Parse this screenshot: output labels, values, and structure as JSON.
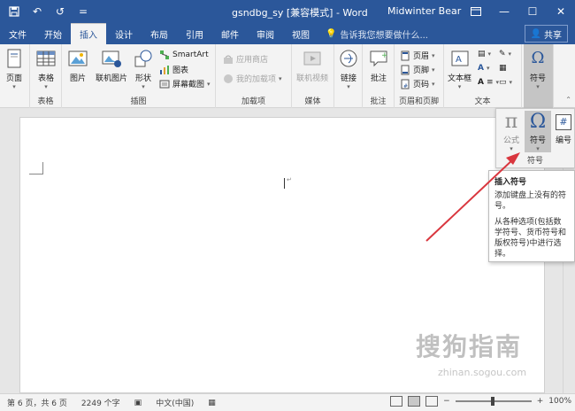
{
  "titlebar": {
    "doc_title": "gsndbg_sy [兼容模式] - Word",
    "user": "Midwinter Bear",
    "qat": [
      "save-icon",
      "undo-icon",
      "redo-icon",
      "customize-icon"
    ],
    "controls": [
      "minimize",
      "restore",
      "close"
    ]
  },
  "tabs": [
    "文件",
    "开始",
    "插入",
    "设计",
    "布局",
    "引用",
    "邮件",
    "审阅",
    "视图"
  ],
  "active_tab": "插入",
  "tell_me": "告诉我您想要做什么...",
  "share": "共享",
  "ribbon": {
    "pages": {
      "label": "页面",
      "group": "页面"
    },
    "tables": {
      "label": "表格",
      "group": "表格"
    },
    "illustrations": {
      "group": "插图",
      "picture": "图片",
      "online_picture": "联机图片",
      "shapes": "形状",
      "smartart": "SmartArt",
      "chart": "图表",
      "screenshot": "屏幕截图"
    },
    "addins": {
      "group": "加载项",
      "store": "应用商店",
      "my_addins": "我的加载项"
    },
    "media": {
      "group": "媒体",
      "online_video": "联机视频"
    },
    "links": {
      "label": "链接"
    },
    "comments": {
      "group": "批注",
      "comment": "批注"
    },
    "header_footer": {
      "group": "页眉和页脚",
      "header": "页眉",
      "footer": "页脚",
      "page_number": "页码"
    },
    "text": {
      "group": "文本",
      "textbox": "文本框"
    },
    "symbols": {
      "label": "符号"
    }
  },
  "symbols_panel": {
    "equation": {
      "glyph": "π",
      "label": "公式"
    },
    "symbol": {
      "glyph": "Ω",
      "label": "符号"
    },
    "number": {
      "glyph": "#",
      "label": "编号"
    },
    "group": "符号"
  },
  "tooltip": {
    "title": "插入符号",
    "desc": "添加键盘上没有的符号。",
    "detail": "从各种选项(包括数学符号、货币符号和版权符号)中进行选择。"
  },
  "statusbar": {
    "page": "第 6 页，共 6 页",
    "words": "2249 个字",
    "language": "中文(中国)",
    "zoom": "100%"
  },
  "watermark": {
    "main": "搜狗指南",
    "sub": "zhinan.sogou.com"
  },
  "colors": {
    "accent": "#2b579a",
    "arrow": "#d9363e"
  }
}
